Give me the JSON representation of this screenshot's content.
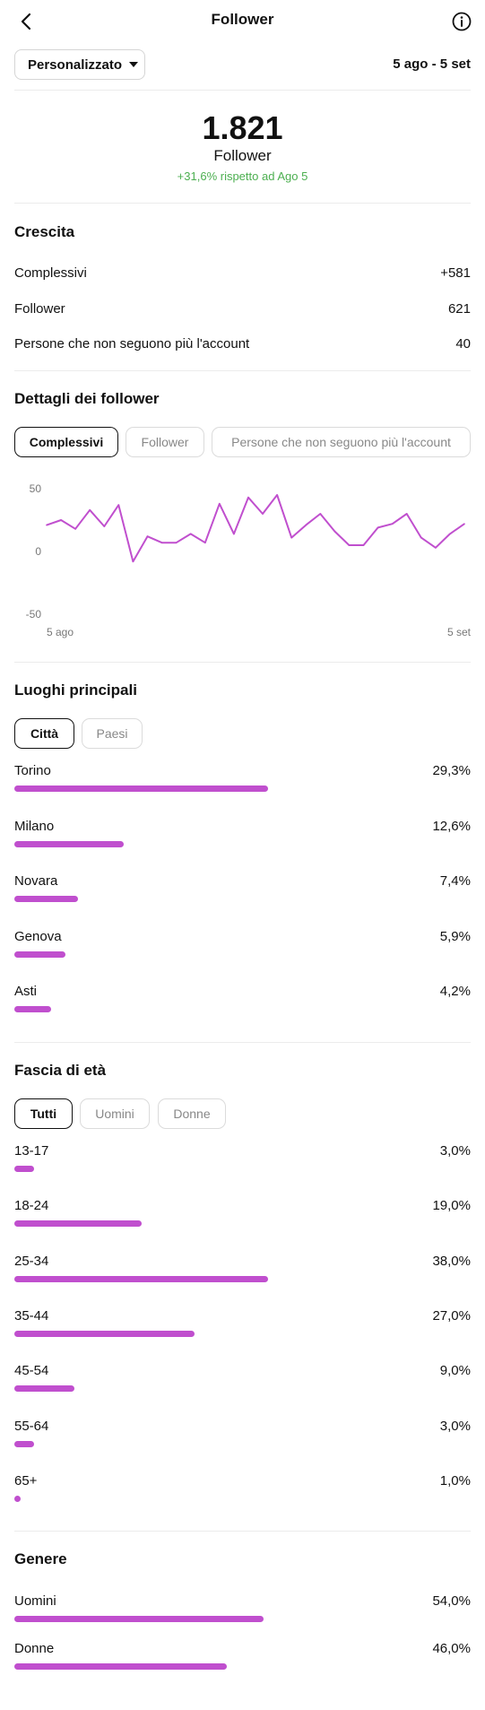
{
  "header": {
    "title": "Follower"
  },
  "filter": {
    "dropdown_label": "Personalizzato",
    "date_range": "5 ago - 5 set"
  },
  "summary": {
    "total": "1.821",
    "label": "Follower",
    "change": "+31,6% rispetto ad Ago 5"
  },
  "growth": {
    "title": "Crescita",
    "rows": [
      {
        "label": "Complessivi",
        "value": "+581"
      },
      {
        "label": "Follower",
        "value": "621"
      },
      {
        "label": "Persone che non seguono più l'account",
        "value": "40"
      }
    ]
  },
  "details": {
    "title": "Dettagli dei follower",
    "tabs": [
      "Complessivi",
      "Follower",
      "Persone che non seguono più l'account"
    ],
    "active_tab": 0
  },
  "chart_data": {
    "type": "line",
    "color": "#c04fce",
    "y_ticks": [
      "50",
      "0",
      "-50"
    ],
    "ylim": [
      -50,
      50
    ],
    "x_start_label": "5 ago",
    "x_end_label": "5 set",
    "values": [
      21,
      25,
      18,
      33,
      20,
      37,
      -8,
      12,
      7,
      7,
      14,
      7,
      38,
      14,
      43,
      30,
      45,
      11,
      21,
      30,
      16,
      5,
      5,
      19,
      22,
      30,
      11,
      3,
      14,
      22
    ]
  },
  "locations": {
    "title": "Luoghi principali",
    "tabs": [
      "Città",
      "Paesi"
    ],
    "active_tab": 0,
    "items": [
      {
        "label": "Torino",
        "value": "29,3%",
        "fraction": 0.293
      },
      {
        "label": "Milano",
        "value": "12,6%",
        "fraction": 0.126
      },
      {
        "label": "Novara",
        "value": "7,4%",
        "fraction": 0.074
      },
      {
        "label": "Genova",
        "value": "5,9%",
        "fraction": 0.059
      },
      {
        "label": "Asti",
        "value": "4,2%",
        "fraction": 0.042
      }
    ]
  },
  "age": {
    "title": "Fascia di età",
    "tabs": [
      "Tutti",
      "Uomini",
      "Donne"
    ],
    "active_tab": 0,
    "items": [
      {
        "label": "13-17",
        "value": "3,0%",
        "fraction": 0.03
      },
      {
        "label": "18-24",
        "value": "19,0%",
        "fraction": 0.19
      },
      {
        "label": "25-34",
        "value": "38,0%",
        "fraction": 0.38
      },
      {
        "label": "35-44",
        "value": "27,0%",
        "fraction": 0.27
      },
      {
        "label": "45-54",
        "value": "9,0%",
        "fraction": 0.09
      },
      {
        "label": "55-64",
        "value": "3,0%",
        "fraction": 0.03
      },
      {
        "label": "65+",
        "value": "1,0%",
        "fraction": 0.01
      }
    ]
  },
  "gender": {
    "title": "Genere",
    "items": [
      {
        "label": "Uomini",
        "value": "54,0%",
        "fraction": 0.54
      },
      {
        "label": "Donne",
        "value": "46,0%",
        "fraction": 0.46
      }
    ]
  }
}
